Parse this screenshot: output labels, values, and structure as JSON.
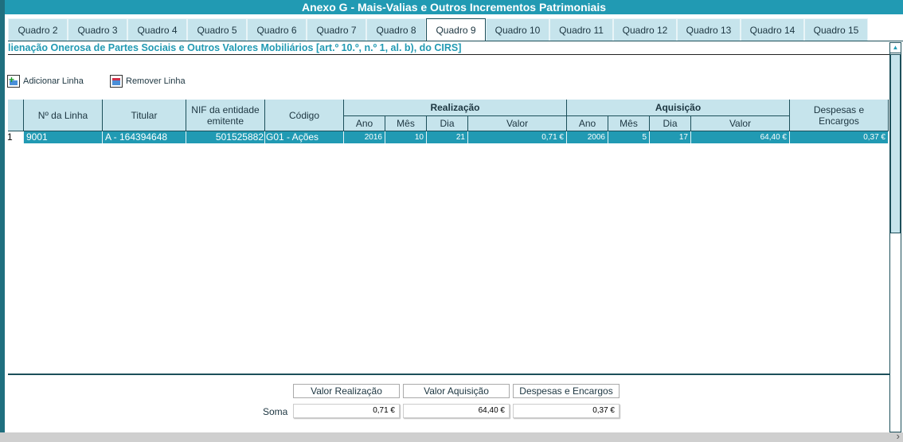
{
  "title": "Anexo G - Mais-Valias e Outros Incrementos Patrimoniais",
  "tabs": [
    "Quadro 2",
    "Quadro 3",
    "Quadro 4",
    "Quadro 5",
    "Quadro 6",
    "Quadro 7",
    "Quadro 8",
    "Quadro 9",
    "Quadro 10",
    "Quadro 11",
    "Quadro 12",
    "Quadro 13",
    "Quadro 14",
    "Quadro 15"
  ],
  "active_tab": "Quadro 9",
  "subtitle": "lienação Onerosa de Partes Sociais e Outros Valores Mobiliários [art.º 10.º, n.º 1, al. b), do CIRS]",
  "toolbar": {
    "add": "Adicionar Linha",
    "remove": "Remover Linha"
  },
  "table": {
    "headers": {
      "linha": "Nº da Linha",
      "titular": "Titular",
      "nif": "NIF da entidade emitente",
      "codigo": "Código",
      "realizacao": "Realização",
      "aquisicao": "Aquisição",
      "despesas": "Despesas e Encargos",
      "ano": "Ano",
      "mes": "Mês",
      "dia": "Dia",
      "valor": "Valor"
    },
    "rows": [
      {
        "n": "1",
        "linha": "9001",
        "titular": "A - 164394648",
        "nif": "501525882",
        "codigo": "G01 - Ações",
        "r_ano": "2016",
        "r_mes": "10",
        "r_dia": "21",
        "r_valor": "0,71 €",
        "a_ano": "2006",
        "a_mes": "5",
        "a_dia": "17",
        "a_valor": "64,40 €",
        "despesas": "0,37 €"
      }
    ]
  },
  "totals": {
    "label": "Soma",
    "h1": "Valor Realização",
    "h2": "Valor Aquisição",
    "h3": "Despesas e Encargos",
    "v1": "0,71 €",
    "v2": "64,40 €",
    "v3": "0,37 €"
  }
}
